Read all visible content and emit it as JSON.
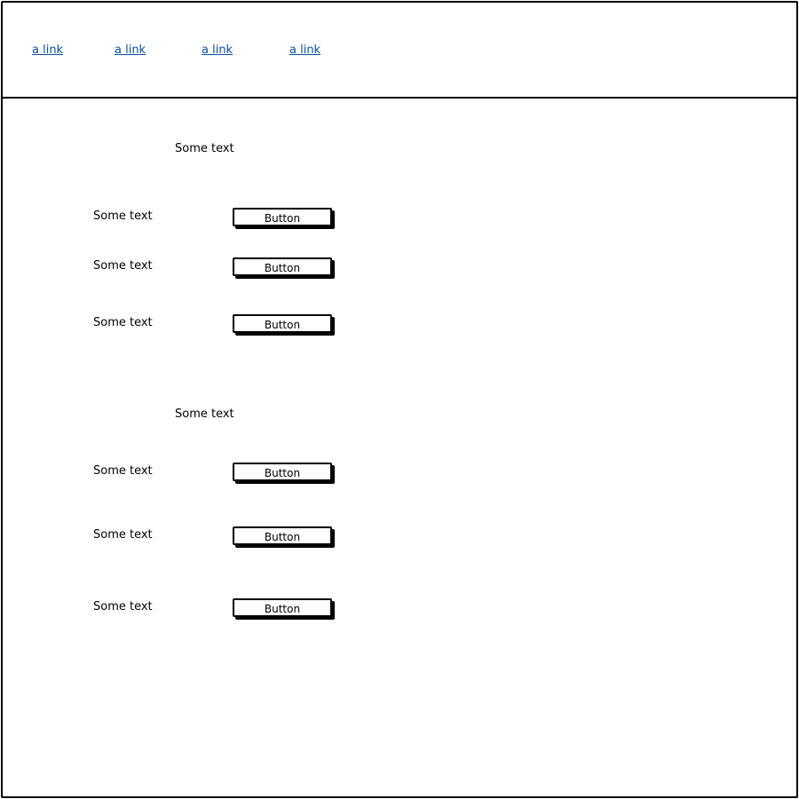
{
  "nav": {
    "links": [
      "a link",
      "a link",
      "a link",
      "a link"
    ],
    "link_color": "#0a4d9c"
  },
  "sections": [
    {
      "title": "Some text",
      "rows": [
        {
          "label": "Some text",
          "button": "Button"
        },
        {
          "label": "Some text",
          "button": "Button"
        },
        {
          "label": "Some text",
          "button": "Button"
        }
      ]
    },
    {
      "title": "Some text",
      "rows": [
        {
          "label": "Some text",
          "button": "Button"
        },
        {
          "label": "Some text",
          "button": "Button"
        },
        {
          "label": "Some text",
          "button": "Button"
        }
      ]
    }
  ]
}
